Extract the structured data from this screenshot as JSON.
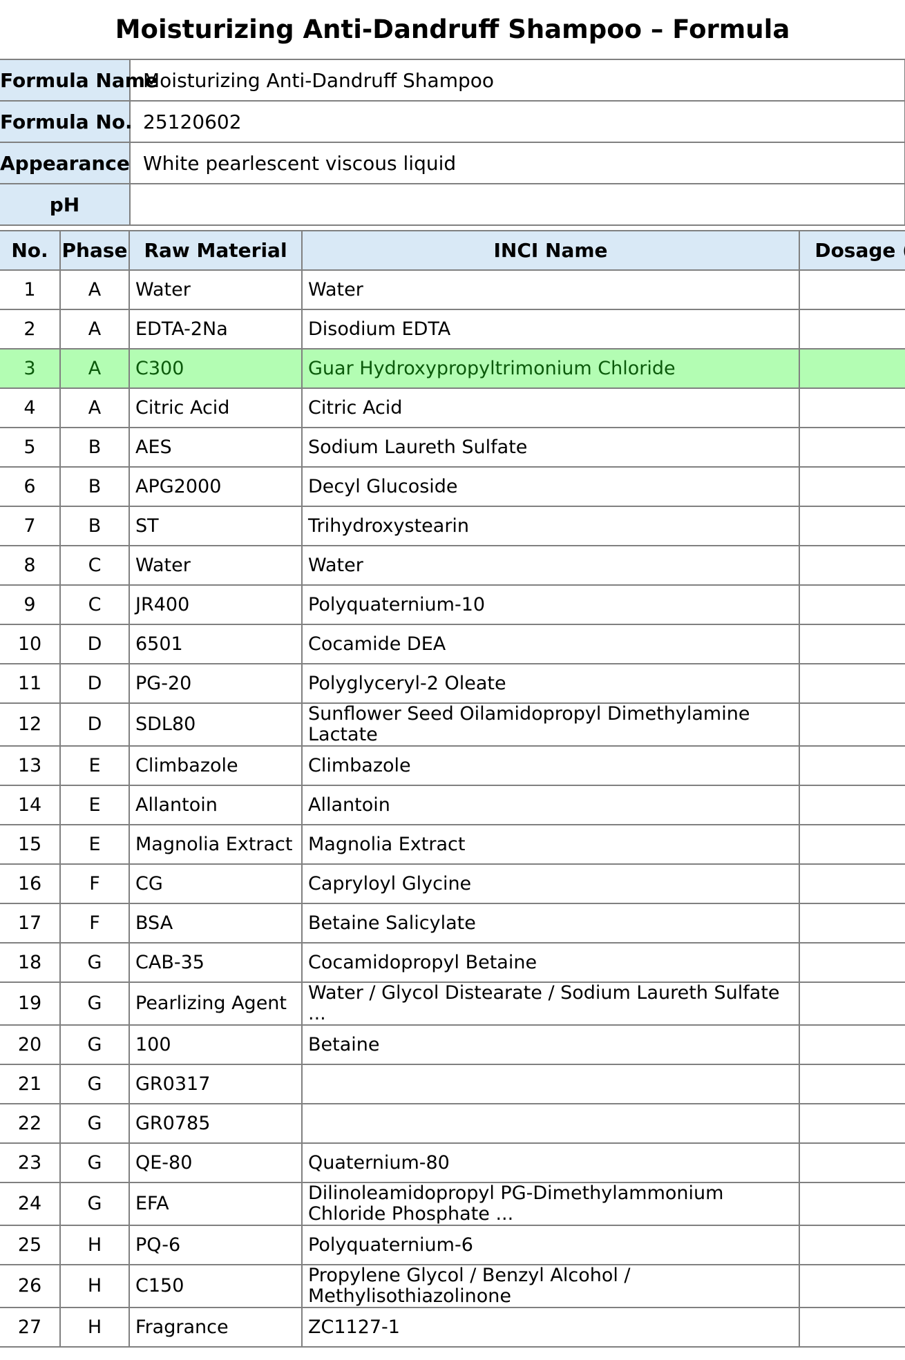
{
  "document": {
    "title": "Moisturizing Anti-Dandruff Shampoo – Formula"
  },
  "info": {
    "formula_name_label": "Formula Name",
    "formula_name_value": "Moisturizing Anti-Dandruff Shampoo",
    "formula_no_label": "Formula No.",
    "formula_no_value": "25120602",
    "appearance_label": "Appearance",
    "appearance_value": "White pearlescent viscous liquid",
    "ph_label": "pH",
    "ph_value": ""
  },
  "table": {
    "headers": {
      "no": "No.",
      "phase": "Phase",
      "raw_material": "Raw Material",
      "inci": "INCI Name",
      "dosage": "Dosage (%"
    },
    "highlight_color": "#b3fdb3",
    "highlighted_row": 3,
    "rows": [
      {
        "no": "1",
        "phase": "A",
        "raw": "Water",
        "inci": "Water",
        "dosage": ""
      },
      {
        "no": "2",
        "phase": "A",
        "raw": "EDTA-2Na",
        "inci": "Disodium EDTA",
        "dosage": ""
      },
      {
        "no": "3",
        "phase": "A",
        "raw": "C300",
        "inci": "Guar Hydroxypropyltrimonium Chloride",
        "dosage": ""
      },
      {
        "no": "4",
        "phase": "A",
        "raw": "Citric Acid",
        "inci": "Citric Acid",
        "dosage": ""
      },
      {
        "no": "5",
        "phase": "B",
        "raw": "AES",
        "inci": "Sodium Laureth Sulfate",
        "dosage": ""
      },
      {
        "no": "6",
        "phase": "B",
        "raw": "APG2000",
        "inci": "Decyl Glucoside",
        "dosage": ""
      },
      {
        "no": "7",
        "phase": "B",
        "raw": "ST",
        "inci": "Trihydroxystearin",
        "dosage": ""
      },
      {
        "no": "8",
        "phase": "C",
        "raw": "Water",
        "inci": "Water",
        "dosage": ""
      },
      {
        "no": "9",
        "phase": "C",
        "raw": "JR400",
        "inci": "Polyquaternium-10",
        "dosage": ""
      },
      {
        "no": "10",
        "phase": "D",
        "raw": "6501",
        "inci": "Cocamide DEA",
        "dosage": ""
      },
      {
        "no": "11",
        "phase": "D",
        "raw": "PG-20",
        "inci": "Polyglyceryl-2 Oleate",
        "dosage": ""
      },
      {
        "no": "12",
        "phase": "D",
        "raw": "SDL80",
        "inci": "Sunflower Seed Oilamidopropyl Dimethylamine Lactate",
        "dosage": ""
      },
      {
        "no": "13",
        "phase": "E",
        "raw": "Climbazole",
        "inci": "Climbazole",
        "dosage": ""
      },
      {
        "no": "14",
        "phase": "E",
        "raw": "Allantoin",
        "inci": "Allantoin",
        "dosage": ""
      },
      {
        "no": "15",
        "phase": "E",
        "raw": "Magnolia Extract",
        "inci": "Magnolia Extract",
        "dosage": ""
      },
      {
        "no": "16",
        "phase": "F",
        "raw": "CG",
        "inci": "Capryloyl Glycine",
        "dosage": ""
      },
      {
        "no": "17",
        "phase": "F",
        "raw": "BSA",
        "inci": "Betaine Salicylate",
        "dosage": ""
      },
      {
        "no": "18",
        "phase": "G",
        "raw": "CAB-35",
        "inci": "Cocamidopropyl Betaine",
        "dosage": ""
      },
      {
        "no": "19",
        "phase": "G",
        "raw": "Pearlizing Agent",
        "inci": "Water / Glycol Distearate / Sodium Laureth Sulfate ...",
        "dosage": ""
      },
      {
        "no": "20",
        "phase": "G",
        "raw": "100",
        "inci": "Betaine",
        "dosage": ""
      },
      {
        "no": "21",
        "phase": "G",
        "raw": "GR0317",
        "inci": "",
        "dosage": ""
      },
      {
        "no": "22",
        "phase": "G",
        "raw": "GR0785",
        "inci": "",
        "dosage": ""
      },
      {
        "no": "23",
        "phase": "G",
        "raw": "QE-80",
        "inci": "Quaternium-80",
        "dosage": ""
      },
      {
        "no": "24",
        "phase": "G",
        "raw": "EFA",
        "inci": "Dilinoleamidopropyl PG-Dimethylammonium Chloride Phosphate ...",
        "dosage": ""
      },
      {
        "no": "25",
        "phase": "H",
        "raw": "PQ-6",
        "inci": "Polyquaternium-6",
        "dosage": ""
      },
      {
        "no": "26",
        "phase": "H",
        "raw": "C150",
        "inci": "Propylene Glycol / Benzyl Alcohol / Methylisothiazolinone",
        "dosage": ""
      },
      {
        "no": "27",
        "phase": "H",
        "raw": "Fragrance",
        "inci": "ZC1127-1",
        "dosage": ""
      }
    ]
  }
}
